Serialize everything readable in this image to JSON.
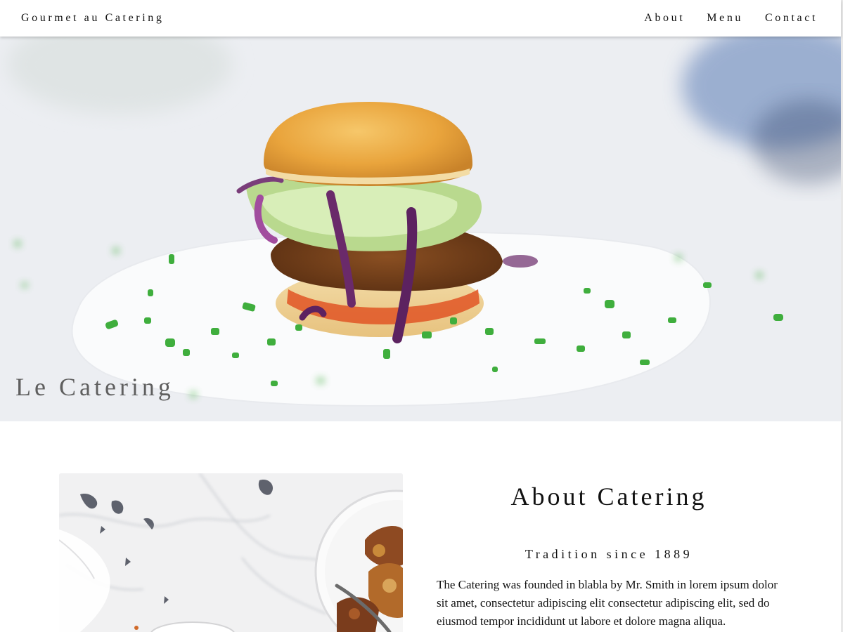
{
  "nav": {
    "brand": "Gourmet au Catering",
    "links": [
      "About",
      "Menu",
      "Contact"
    ]
  },
  "hero": {
    "title": "Le Catering",
    "image_subject": "burger on white paper with chives"
  },
  "about": {
    "title": "About Catering",
    "subtitle": "Tradition since 1889",
    "text": "The Catering was founded in blabla by Mr. Smith in lorem ipsum dolor sit amet, consectetur adipiscing elit consectetur adipiscing elit, sed do eiusmod tempor incididunt ut labore et dolore magna aliqua.",
    "image_subject": "marble table with plates of food"
  },
  "colors": {
    "nav_bg": "#ffffff",
    "text": "#111111",
    "hero_title": "#5f5f5f"
  }
}
